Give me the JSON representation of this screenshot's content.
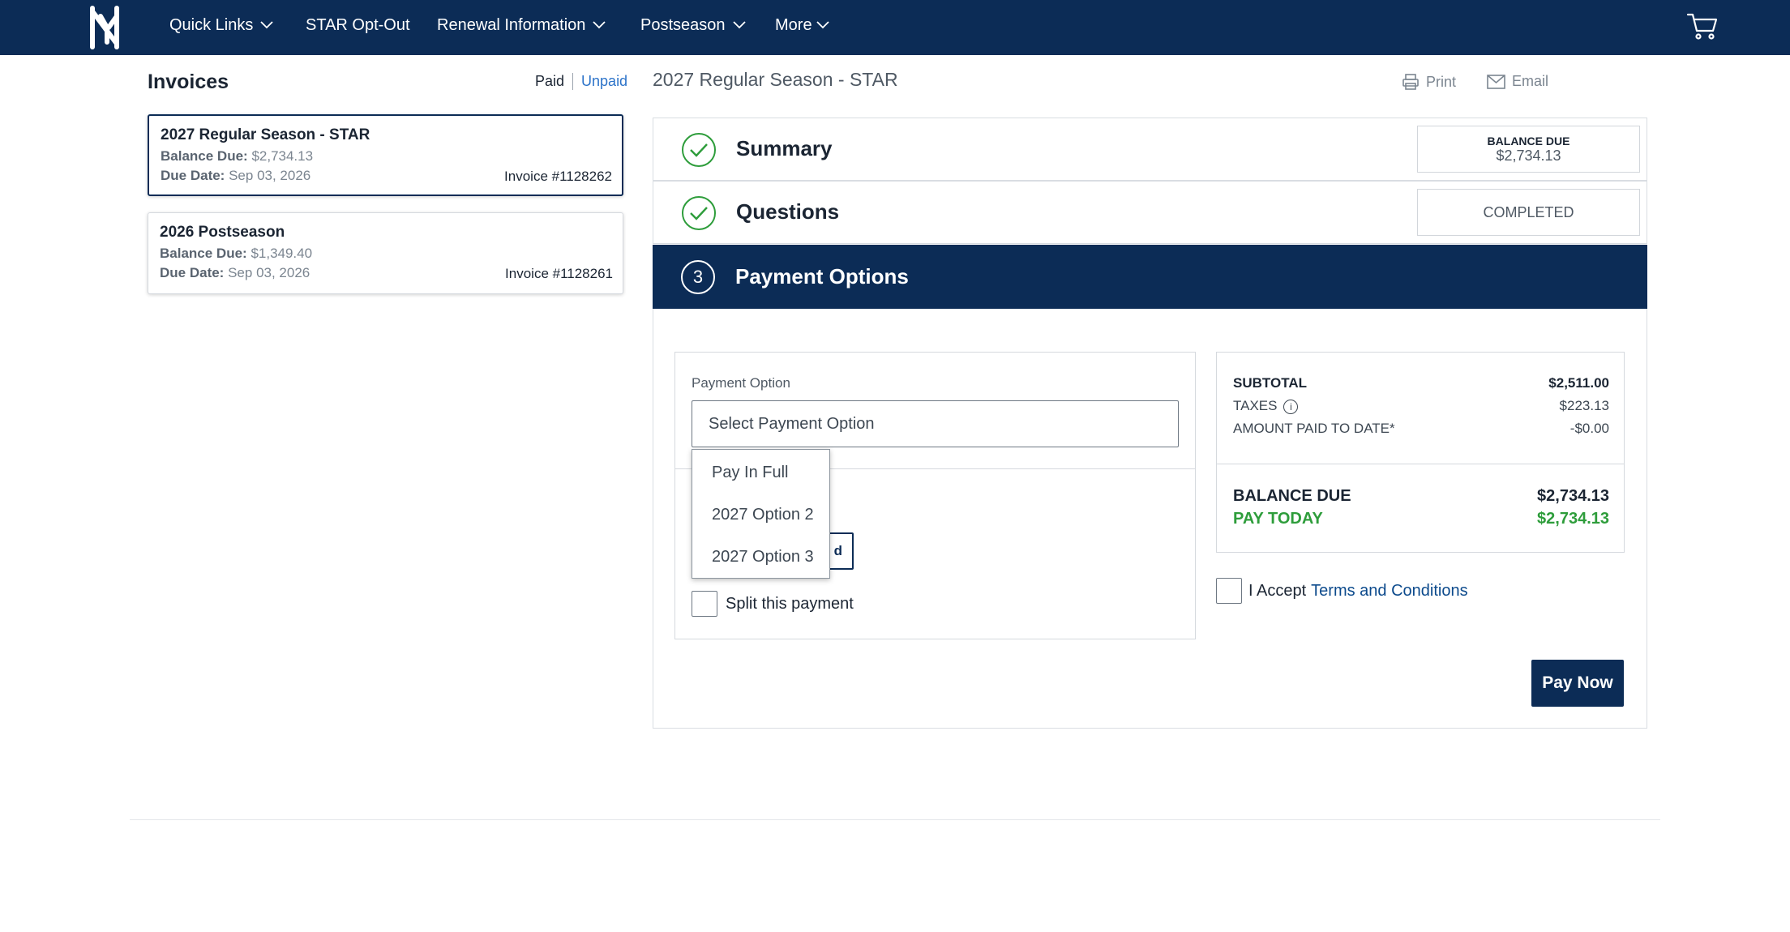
{
  "nav": {
    "items": [
      {
        "label": "Quick Links",
        "has_dropdown": true
      },
      {
        "label": "STAR Opt-Out",
        "has_dropdown": false
      },
      {
        "label": "Renewal Information",
        "has_dropdown": true
      },
      {
        "label": "Postseason",
        "has_dropdown": true
      },
      {
        "label": "More",
        "has_dropdown": true
      }
    ],
    "logo": "ny-logo",
    "cart_icon": "cart-icon"
  },
  "invoices": {
    "title": "Invoices",
    "filter_paid": "Paid",
    "filter_unpaid": "Unpaid",
    "cards": [
      {
        "title": "2027 Regular Season - STAR",
        "balance_label": "Balance Due:",
        "balance": "$2,734.13",
        "due_label": "Due Date:",
        "due": "Sep 03, 2026",
        "invoice": "Invoice #1128262",
        "selected": true
      },
      {
        "title": "2026 Postseason",
        "balance_label": "Balance Due:",
        "balance": "$1,349.40",
        "due_label": "Due Date:",
        "due": "Sep 03, 2026",
        "invoice": "Invoice #1128261",
        "selected": false
      }
    ]
  },
  "detail": {
    "title": "2027 Regular Season - STAR",
    "print_label": "Print",
    "email_label": "Email",
    "steps": {
      "summary": {
        "label": "Summary",
        "badge_title": "BALANCE DUE",
        "badge_value": "$2,734.13"
      },
      "questions": {
        "label": "Questions",
        "badge_value": "COMPLETED"
      },
      "payment": {
        "number": "3",
        "label": "Payment Options"
      }
    },
    "payment": {
      "option_label": "Payment Option",
      "select_placeholder": "Select Payment Option",
      "options": [
        "Pay In Full",
        "2027 Option 2",
        "2027 Option 3"
      ],
      "hidden_button_text": "d",
      "split_label": "Split this payment"
    },
    "summary": {
      "subtotal_label": "SUBTOTAL",
      "subtotal": "$2,511.00",
      "taxes_label": "TAXES",
      "taxes": "$223.13",
      "paid_label": "AMOUNT PAID TO DATE*",
      "paid": "-$0.00",
      "balance_label": "BALANCE DUE",
      "balance": "$2,734.13",
      "today_label": "PAY TODAY",
      "today": "$2,734.13"
    },
    "accept_label": "I Accept",
    "terms_label": "Terms and Conditions",
    "pay_now_label": "Pay Now"
  },
  "colors": {
    "brand_navy": "#0c2c56",
    "success_green": "#2e9d3b",
    "link_blue": "#2c73c9"
  }
}
